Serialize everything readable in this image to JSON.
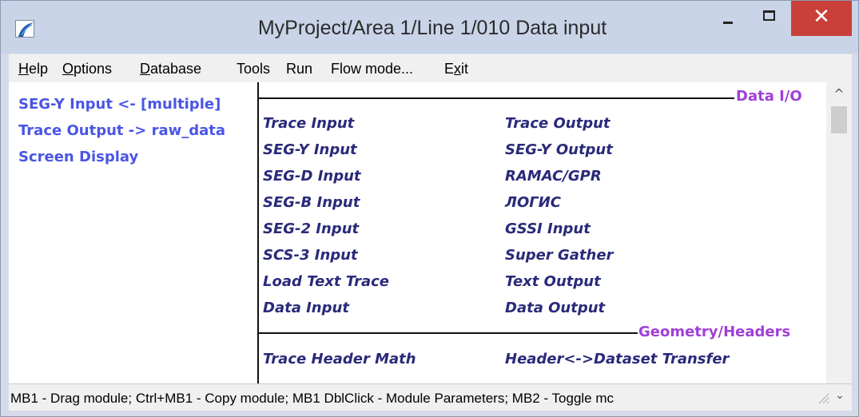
{
  "window": {
    "title": "MyProject/Area 1/Line 1/010 Data input",
    "close_glyph": "✕"
  },
  "menu": [
    {
      "pre": "",
      "ul": "H",
      "post": "elp"
    },
    {
      "pre": "",
      "ul": "O",
      "post": "ptions"
    },
    {
      "pre": "",
      "ul": "D",
      "post": "atabase"
    },
    {
      "pre": "Tools",
      "ul": "",
      "post": ""
    },
    {
      "pre": "Run",
      "ul": "",
      "post": ""
    },
    {
      "pre": "Flow mode...",
      "ul": "",
      "post": ""
    },
    {
      "pre": "E",
      "ul": "x",
      "post": "it"
    }
  ],
  "flow": [
    "SEG-Y Input <- [multiple]",
    "Trace Output -> raw_data",
    "Screen Display"
  ],
  "sections": [
    {
      "title": "Data I/O",
      "modules": [
        [
          "Trace Input",
          "Trace Output"
        ],
        [
          "SEG-Y Input",
          "SEG-Y Output"
        ],
        [
          "SEG-D Input",
          "RAMAC/GPR"
        ],
        [
          "SEG-B Input",
          "ЛОГИС"
        ],
        [
          "SEG-2 Input",
          "GSSI Input"
        ],
        [
          "SCS-3 Input",
          "Super Gather"
        ],
        [
          "Load Text Trace",
          "Text Output"
        ],
        [
          "Data Input",
          "Data Output"
        ]
      ]
    },
    {
      "title": "Geometry/Headers",
      "modules": [
        [
          "Trace Header Math",
          "Header<->Dataset Transfer"
        ]
      ]
    }
  ],
  "status": "MB1 - Drag module; Ctrl+MB1 - Copy module; MB1  DblClick - Module Parameters; MB2 - Toggle mc",
  "scroll": {
    "up": "^",
    "down": "⌄"
  },
  "colors": {
    "flow_item": "#4a55e6",
    "section_title": "#a03fd8",
    "module": "#2a2a7a",
    "close": "#c9403a"
  }
}
